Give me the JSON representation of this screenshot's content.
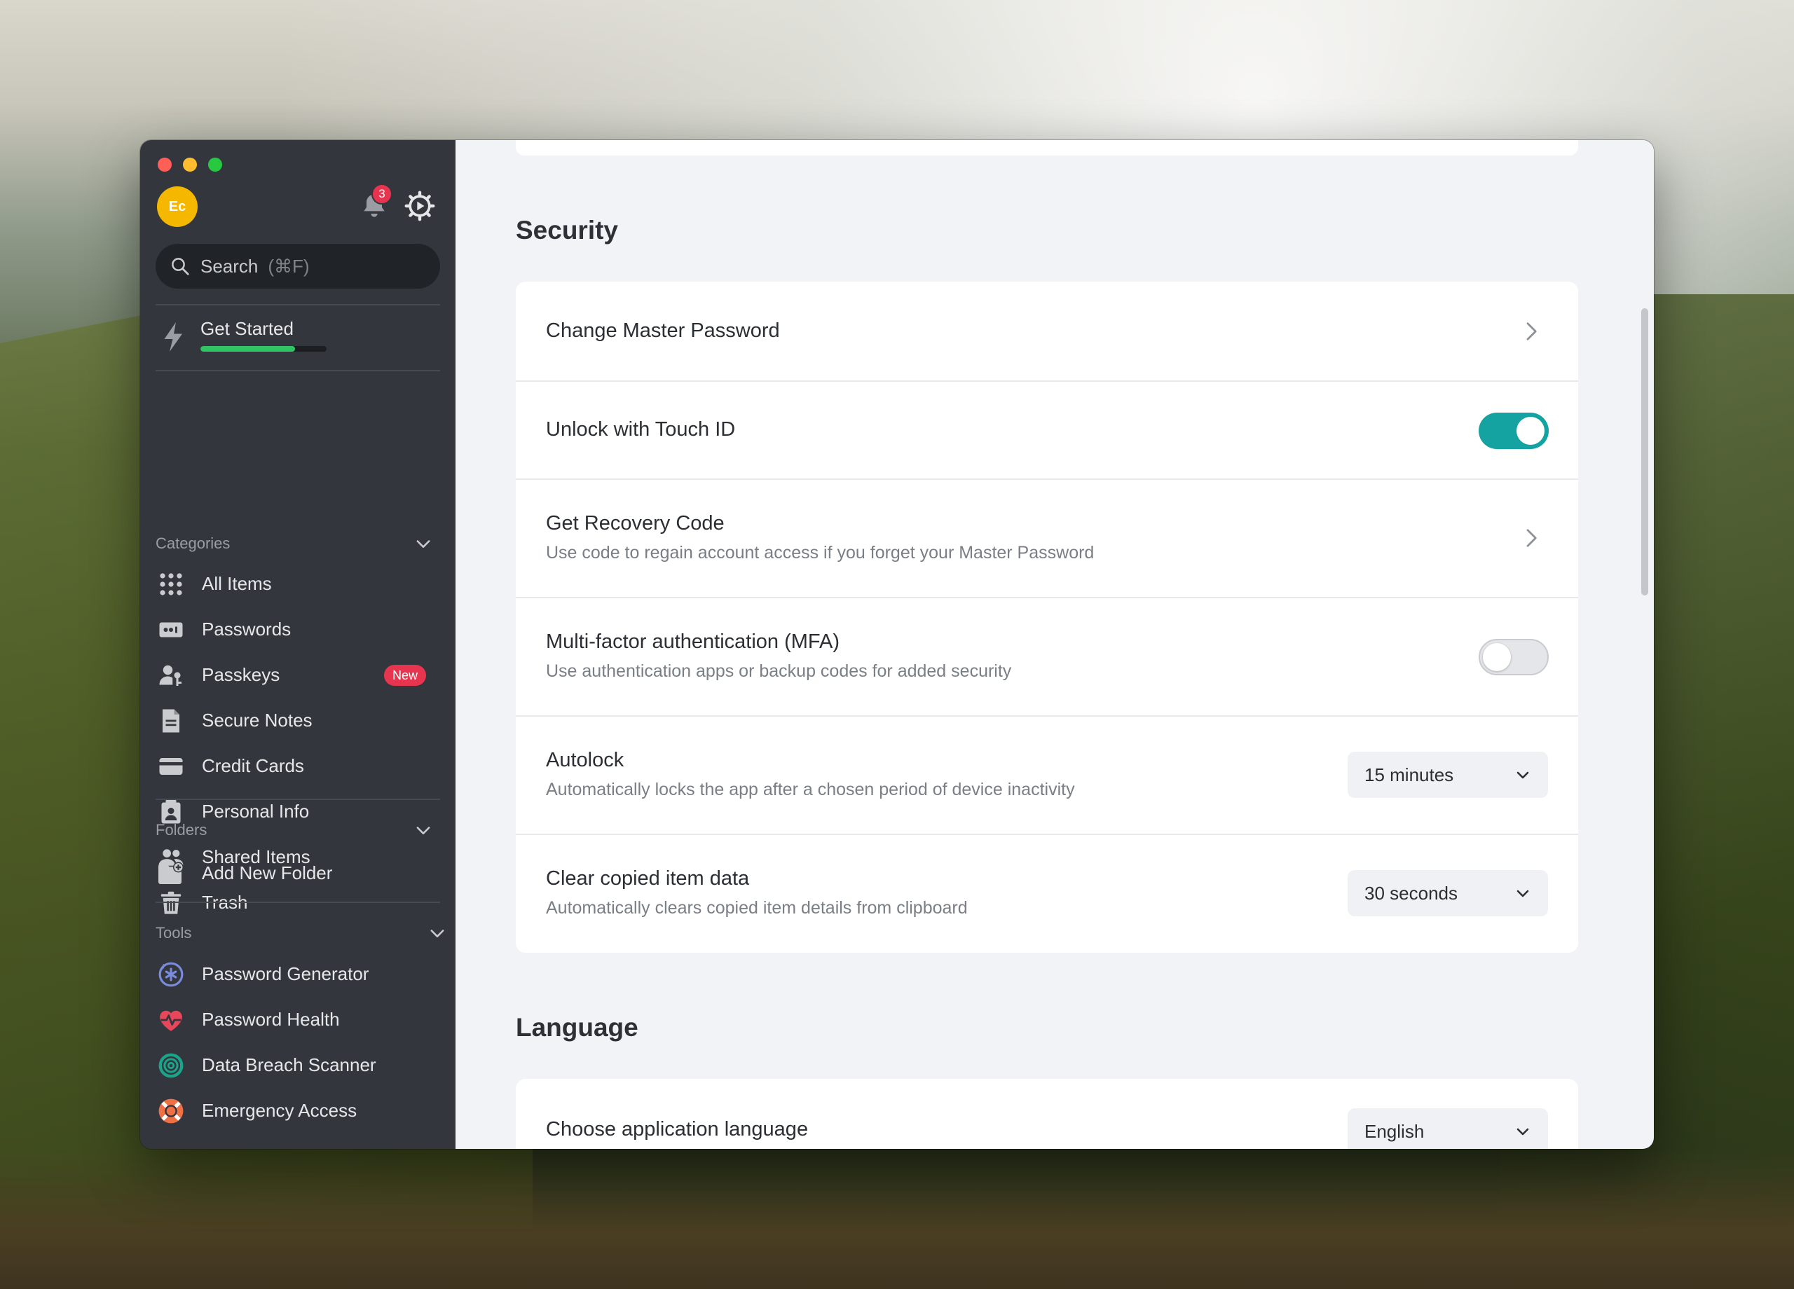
{
  "sidebar": {
    "avatar_initials": "Ec",
    "notification_count": "3",
    "search": {
      "label": "Search",
      "shortcut": "(⌘F)"
    },
    "get_started": {
      "label": "Get Started",
      "progress_fraction": 0.75
    },
    "categories_label": "Categories",
    "categories": [
      {
        "label": "All Items",
        "icon": "grid-icon"
      },
      {
        "label": "Passwords",
        "icon": "password-icon"
      },
      {
        "label": "Passkeys",
        "icon": "passkey-icon",
        "badge": "New"
      },
      {
        "label": "Secure Notes",
        "icon": "note-icon"
      },
      {
        "label": "Credit Cards",
        "icon": "credit-card-icon"
      },
      {
        "label": "Personal Info",
        "icon": "personal-info-icon"
      },
      {
        "label": "Shared Items",
        "icon": "shared-users-icon"
      },
      {
        "label": "Trash",
        "icon": "trash-icon"
      }
    ],
    "folders_label": "Folders",
    "add_folder_label": "Add New Folder",
    "tools_label": "Tools",
    "tools": [
      {
        "label": "Password Generator",
        "icon": "password-generator-icon"
      },
      {
        "label": "Password Health",
        "icon": "heart-pulse-icon"
      },
      {
        "label": "Data Breach Scanner",
        "icon": "radar-icon"
      },
      {
        "label": "Emergency Access",
        "icon": "lifebuoy-icon"
      }
    ]
  },
  "main": {
    "security_title": "Security",
    "rows": {
      "change_password": {
        "title": "Change Master Password"
      },
      "touch_id": {
        "title": "Unlock with Touch ID",
        "enabled": true
      },
      "recovery": {
        "title": "Get Recovery Code",
        "subtitle": "Use code to regain account access if you forget your Master Password"
      },
      "mfa": {
        "title": "Multi-factor authentication (MFA)",
        "subtitle": "Use authentication apps or backup codes for added security",
        "enabled": false
      },
      "autolock": {
        "title": "Autolock",
        "subtitle": "Automatically locks the app after a chosen period of device inactivity",
        "value": "15 minutes"
      },
      "clear_clipboard": {
        "title": "Clear copied item data",
        "subtitle": "Automatically clears copied item details from clipboard",
        "value": "30 seconds"
      }
    },
    "language_title": "Language",
    "language_row": {
      "title": "Choose application language",
      "value": "English"
    }
  },
  "colors": {
    "sidebar_bg": "#33373d",
    "accent_toggle": "#14a3a0",
    "badge_red": "#e8354f",
    "progress_green": "#2fc464",
    "avatar_yellow": "#f5b700"
  }
}
